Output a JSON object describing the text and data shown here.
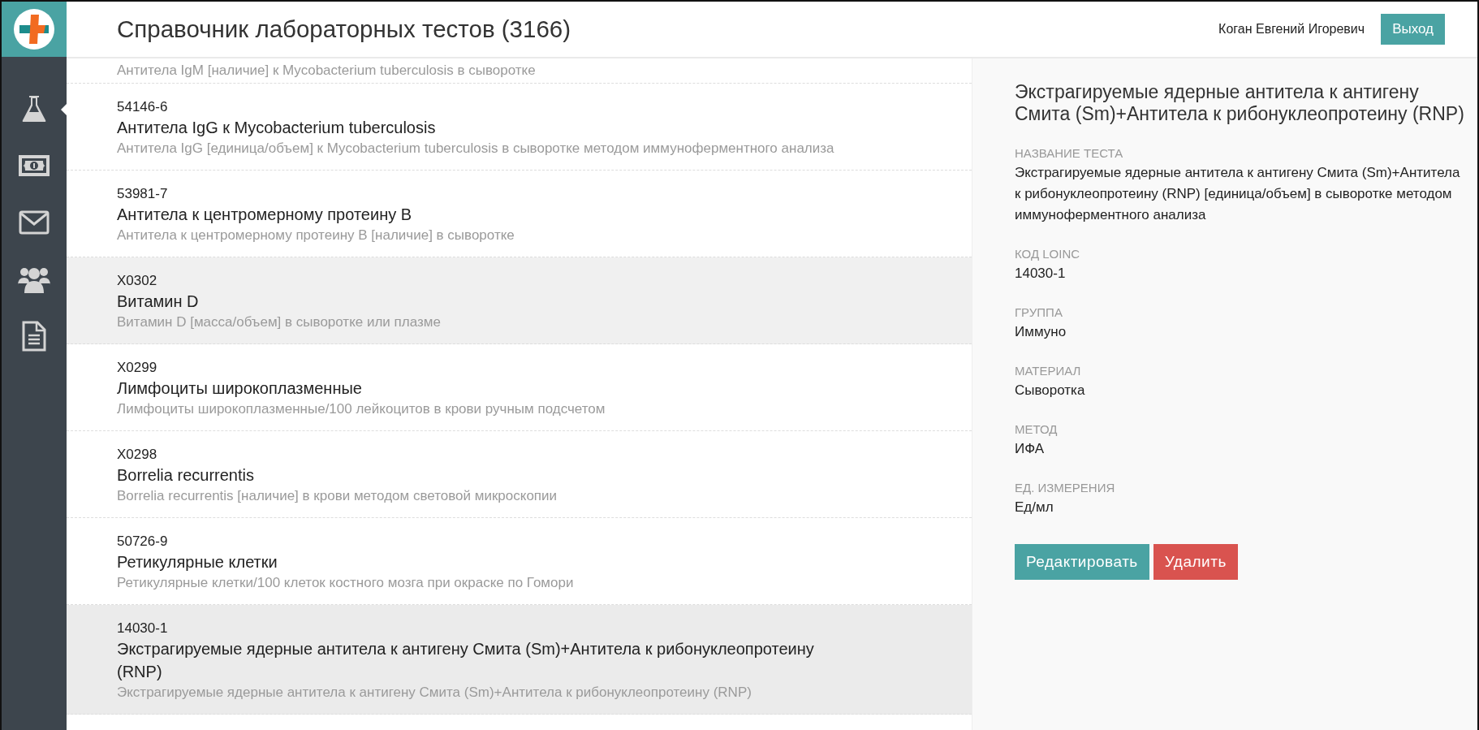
{
  "header": {
    "title": "Справочник лабораторных тестов (3166)",
    "user": "Коган Евгений Игоревич",
    "logout": "Выход"
  },
  "sidebar": {
    "items": [
      {
        "kind": "flask",
        "selected": true
      },
      {
        "kind": "money",
        "selected": false
      },
      {
        "kind": "mail",
        "selected": false
      },
      {
        "kind": "users",
        "selected": false
      },
      {
        "kind": "document",
        "selected": false
      }
    ]
  },
  "tests": [
    {
      "description": "Антитела IgM [наличие] к Mycobacterium tuberculosis в сыворотке",
      "selected": false,
      "hovered": false
    },
    {
      "code": "54146-6",
      "name": "Антитела IgG к Mycobacterium tuberculosis",
      "description": "Антитела IgG [единица/объем] к Mycobacterium tuberculosis в сыворотке методом иммуноферментного анализа",
      "selected": false,
      "hovered": false
    },
    {
      "code": "53981-7",
      "name": "Антитела к центромерному протеину B",
      "description": "Антитела к центромерному протеину B [наличие] в сыворотке",
      "selected": false,
      "hovered": false
    },
    {
      "code": "X0302",
      "name": "Витамин D",
      "description": "Витамин D [масса/объем] в сыворотке или плазме",
      "selected": false,
      "hovered": true
    },
    {
      "code": "X0299",
      "name": "Лимфоциты широкоплазменные",
      "description": "Лимфоциты широкоплазменные/100 лейкоцитов в крови ручным подсчетом",
      "selected": false,
      "hovered": false
    },
    {
      "code": "X0298",
      "name": "Borrelia recurrentis",
      "description": "Borrelia recurrentis [наличие] в крови методом световой микроскопии",
      "selected": false,
      "hovered": false
    },
    {
      "code": "50726-9",
      "name": "Ретикулярные клетки",
      "description": "Ретикулярные клетки/100 клеток костного мозга при окраске по Гомори",
      "selected": false,
      "hovered": false
    },
    {
      "code": "14030-1",
      "name": "Экстрагируемые ядерные антитела к антигену Смита (Sm)+Антитела к рибонуклеопротеину (RNP)",
      "description": "Экстрагируемые ядерные антитела к антигену Смита (Sm)+Антитела к рибонуклеопротеину (RNP)",
      "selected": true,
      "hovered": false
    }
  ],
  "detail": {
    "title": "Экстрагируемые ядерные антитела к антигену Смита (Sm)+Антитела к рибонуклеопротеину (RNP)",
    "fields": [
      {
        "label": "НАЗВАНИЕ ТЕСТА",
        "value": "Экстрагируемые ядерные антитела к антигену Смита (Sm)+Антитела к рибонуклеопротеину (RNP) [единица/объем] в сыворотке методом иммуноферментного анализа"
      },
      {
        "label": "КОД LOINC",
        "value": "14030-1"
      },
      {
        "label": "ГРУППА",
        "value": "Иммуно"
      },
      {
        "label": "МАТЕРИАЛ",
        "value": "Сыворотка"
      },
      {
        "label": "МЕТОД",
        "value": "ИФА"
      },
      {
        "label": "ЕД. ИЗМЕРЕНИЯ",
        "value": "Ед/мл"
      }
    ],
    "buttons": [
      {
        "kind": "edit",
        "label": "Редактировать"
      },
      {
        "kind": "delete",
        "label": "Удалить"
      }
    ]
  }
}
